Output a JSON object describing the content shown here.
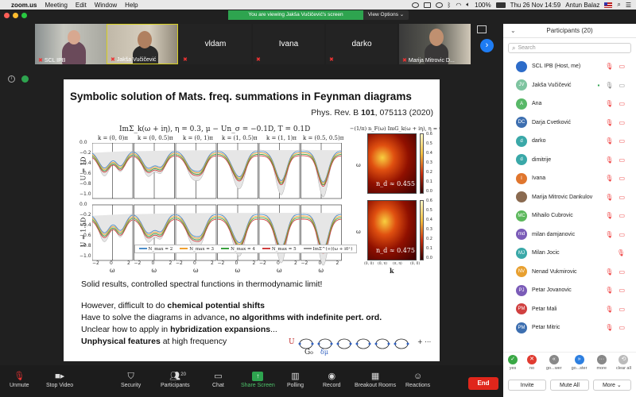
{
  "menubar": {
    "app": "zoom.us",
    "items": [
      "Meeting",
      "Edit",
      "Window",
      "Help"
    ],
    "battery": "100%",
    "datetime": "Thu 26 Nov  14:59",
    "user": "Antun Balaz"
  },
  "banner": {
    "text": "You are viewing Jakša Vučičević's screen",
    "view_options": "View Options ⌄"
  },
  "video": {
    "tiles": [
      {
        "name": "SCL IPB",
        "photo": true
      },
      {
        "name": "Jakša Vučičević",
        "photo": true,
        "active": true
      },
      {
        "name": "vldam",
        "photo": false
      },
      {
        "name": "Ivana",
        "photo": false
      },
      {
        "name": "darko",
        "photo": false
      },
      {
        "name": "Marija Mitrovic D...",
        "photo": true
      }
    ]
  },
  "slide": {
    "title": "Symbolic solution of Mats. freq. summations in Feynman diagrams",
    "ref_prefix": "Phys. Rev. B ",
    "ref_vol": "101",
    "ref_suffix": ", 075113 (2020)",
    "formula": "ImΣ_k(ω + iη),  η = 0.3,  μ − Un_σ = −0.1D,  T = 0.1D",
    "heat_formula": "−(1/π) n_F(ω) ImG_k(ω + iη), η = 0.3",
    "k_labels": [
      "k = (0, 0)π",
      "k = (0, 0.5)π",
      "k = (0, 1)π",
      "k = (1, 0.5)π",
      "k = (1, 1)π",
      "k = (0.5, 0.5)π"
    ],
    "row_labels": [
      "U = 1D",
      "U = 1.5D"
    ],
    "y_ticks_top": [
      "0.0",
      "−0.2",
      "−0.4",
      "−0.6",
      "−0.8",
      "−1.0"
    ],
    "y_ticks_bottom": [
      "0.0",
      "−0.2",
      "−0.4",
      "−0.6",
      "−0.8",
      "−1.0"
    ],
    "x_ticks": [
      "−2",
      "0",
      "2"
    ],
    "x_label": "ω",
    "legend": [
      "N_max = 2",
      "N_max = 3",
      "N_max = 4",
      "N_max = 5",
      "ImΣ^(∞)(ω + i0⁺)"
    ],
    "legend_colors": [
      "#4c8dc9",
      "#f0a030",
      "#3aa040",
      "#d04040",
      "#999999"
    ],
    "heatmaps": [
      {
        "nd": "n_d ≈ 0.455",
        "cbar": [
          "0.6",
          "0.5",
          "0.4",
          "0.3",
          "0.2",
          "0.1",
          "0.0"
        ]
      },
      {
        "nd": "n_d ≈ 0.475",
        "cbar": [
          "0.6",
          "0.5",
          "0.4",
          "0.3",
          "0.2",
          "0.1",
          "0.0"
        ]
      }
    ],
    "heat_y": "ω",
    "heat_x": "k",
    "heat_xticks": [
      "(0, 0)",
      "(0, π)",
      "(π, π)",
      "(0, 0)"
    ],
    "lines": [
      {
        "parts": [
          {
            "t": "Solid results, controlled spectral functions in thermodynamic limit!",
            "b": false
          }
        ]
      },
      {
        "parts": [
          {
            "t": "However, difficult to do ",
            "b": false
          },
          {
            "t": "chemical potential shifts",
            "b": true
          }
        ]
      },
      {
        "parts": [
          {
            "t": "Have to solve the diagrams in advance",
            "b": false
          },
          {
            "t": ", no algorithms with indefinite pert. ord.",
            "b": true
          }
        ]
      },
      {
        "parts": [
          {
            "t": "Unclear how to apply in ",
            "b": false
          },
          {
            "t": "hybridization expansions",
            "b": true
          },
          {
            "t": "...",
            "b": false
          }
        ]
      },
      {
        "parts": [
          {
            "t": "Unphysical features",
            "b": true
          },
          {
            "t": " at high frequency",
            "b": false
          }
        ]
      }
    ],
    "diagram": {
      "u": "U",
      "g0": "G₀",
      "dmu": "δμ",
      "dots": "+ ⋯"
    }
  },
  "participants": {
    "title": "Participants (20)",
    "search_placeholder": "Search",
    "list": [
      {
        "name": "SCL IPB (Host, me)",
        "initials": "",
        "color": "#2d6cc9",
        "icons": [
          "mic-off",
          "video-off"
        ]
      },
      {
        "name": "Jakša Vučičević",
        "initials": "JV",
        "color": "#7ec4a0",
        "icons": [
          "share",
          "mic",
          "video"
        ]
      },
      {
        "name": "Ana",
        "initials": "A",
        "color": "#58b868",
        "icons": [
          "mic-off",
          "video-off"
        ]
      },
      {
        "name": "Darja Cvetković",
        "initials": "DC",
        "color": "#3d6fb0",
        "icons": [
          "mic-off",
          "video-off"
        ]
      },
      {
        "name": "darko",
        "initials": "d",
        "color": "#3aa8a8",
        "icons": [
          "mic-off",
          "video-off"
        ]
      },
      {
        "name": "dimitrije",
        "initials": "d",
        "color": "#3aa8a8",
        "icons": [
          "mic-off",
          "video-off"
        ]
      },
      {
        "name": "Ivana",
        "initials": "I",
        "color": "#e0762e",
        "icons": [
          "mic-off",
          "video-off"
        ]
      },
      {
        "name": "Marija Mitrovic Dankulov",
        "initials": "",
        "color": "#8a6a50",
        "icons": [
          "mic-off",
          "video-off"
        ]
      },
      {
        "name": "Mihailo Cubrovic",
        "initials": "MC",
        "color": "#5cb85c",
        "icons": [
          "mic-off",
          "video-off"
        ]
      },
      {
        "name": "milan damjanovic",
        "initials": "md",
        "color": "#7b5cb8",
        "icons": [
          "mic-off",
          "video-off"
        ]
      },
      {
        "name": "Milan Jocic",
        "initials": "MJ",
        "color": "#3aa8a8",
        "icons": [
          "mic-off"
        ]
      },
      {
        "name": "Nenad Vukmirovic",
        "initials": "NV",
        "color": "#e8a030",
        "icons": [
          "mic-off",
          "video-off"
        ]
      },
      {
        "name": "Petar Jovanovic",
        "initials": "PJ",
        "color": "#7b5cb8",
        "icons": [
          "mic-off",
          "video-off"
        ]
      },
      {
        "name": "Petar Mali",
        "initials": "PM",
        "color": "#d04040",
        "icons": [
          "mic-off",
          "video-off"
        ]
      },
      {
        "name": "Petar Mitric",
        "initials": "PM",
        "color": "#3d6fb0",
        "icons": [
          "mic-off",
          "video-off"
        ]
      }
    ],
    "reactions": [
      {
        "label": "yes",
        "glyph": "✓",
        "color": "#3aa845"
      },
      {
        "label": "no",
        "glyph": "✕",
        "color": "#e03b30"
      },
      {
        "label": "go...wer",
        "glyph": "«",
        "color": "#888888"
      },
      {
        "label": "go...ster",
        "glyph": "»",
        "color": "#2d7fe0"
      },
      {
        "label": "more",
        "glyph": "···",
        "color": "#888888"
      },
      {
        "label": "clear all",
        "glyph": "⟲",
        "color": "#bbbbbb"
      }
    ],
    "invite": "Invite",
    "mute_all": "Mute All",
    "more": "More ⌄"
  },
  "toolbar": {
    "unmute": "Unmute",
    "stop_video": "Stop Video",
    "security": "Security",
    "participants": "Participants",
    "participants_count": "20",
    "chat": "Chat",
    "share_screen": "Share Screen",
    "polling": "Polling",
    "record": "Record",
    "breakout": "Breakout Rooms",
    "reactions": "Reactions",
    "end": "End"
  }
}
